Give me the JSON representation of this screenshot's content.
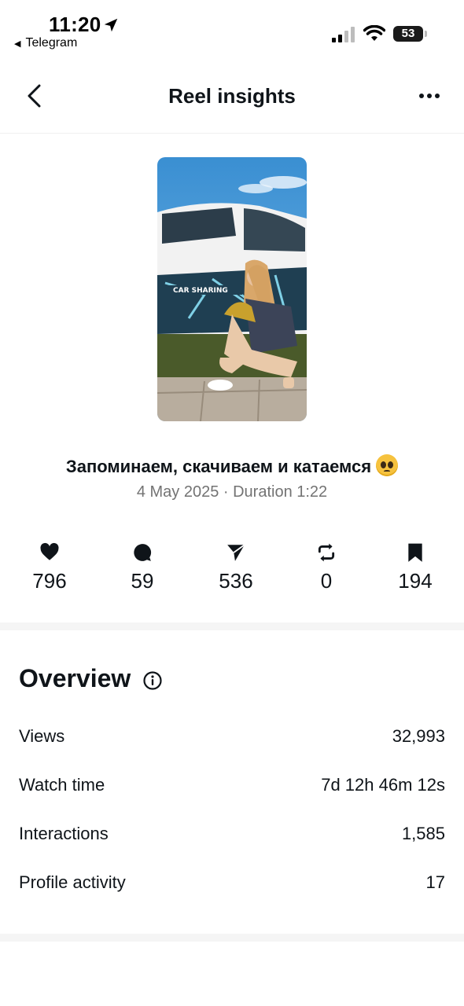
{
  "status_bar": {
    "time": "11:20",
    "back_app": "Telegram",
    "battery": "53"
  },
  "nav": {
    "title": "Reel insights"
  },
  "reel": {
    "title": "Запоминаем, скачиваем и катаемся",
    "meta": "4 May 2025 · Duration 1:22",
    "thumbnail_text": "CAR SHARING"
  },
  "stats": [
    {
      "icon": "heart-icon",
      "value": "796"
    },
    {
      "icon": "comment-icon",
      "value": "59"
    },
    {
      "icon": "share-icon",
      "value": "536"
    },
    {
      "icon": "repost-icon",
      "value": "0"
    },
    {
      "icon": "bookmark-icon",
      "value": "194"
    }
  ],
  "overview": {
    "title": "Overview",
    "rows": [
      {
        "label": "Views",
        "value": "32,993"
      },
      {
        "label": "Watch time",
        "value": "7d 12h 46m 12s"
      },
      {
        "label": "Interactions",
        "value": "1,585"
      },
      {
        "label": "Profile activity",
        "value": "17"
      }
    ]
  },
  "colors": {
    "text": "#0f1419",
    "secondary_text": "#737373",
    "divider": "#f5f5f5"
  }
}
